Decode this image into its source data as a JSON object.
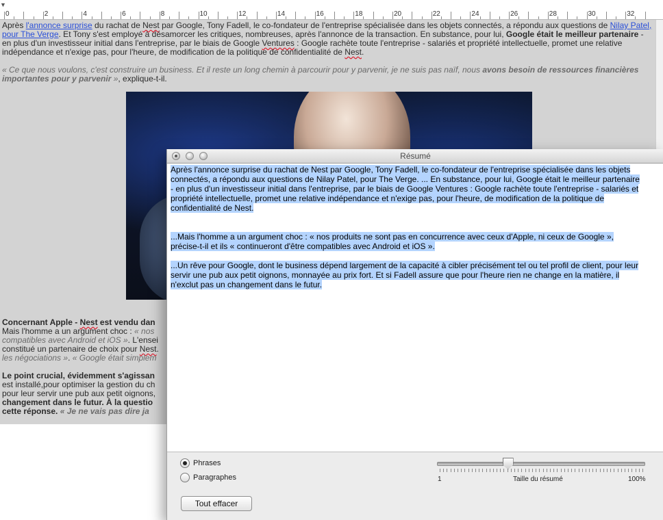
{
  "ruler": {
    "numbers": [
      "0",
      "2",
      "4",
      "6",
      "8",
      "10",
      "12",
      "14",
      "16",
      "18",
      "20",
      "22",
      "24",
      "26",
      "28",
      "30",
      "32"
    ]
  },
  "document": {
    "p1": {
      "a": "Après ",
      "link1": "l'annonce surprise",
      "b": " du rachat de ",
      "nest": "Nest",
      "c": " par Google, Tony Fadell, le co-fondateur de l'entreprise spécialisée dans les objets connectés, a répondu aux questions de ",
      "link2": "Nilay Patel, pour The Verge",
      "d": ". Et Tony s'est employé à désamorcer les critiques, nombreuses, après l'annonce de la transaction. En substance, pour lui, ",
      "bold1": "Google était le meilleur partenaire",
      "e": " - en plus d'un investisseur initial dans l'entreprise, par le biais de Google ",
      "ventures": "Ventures",
      "f": " : Google rachète toute l'entreprise - salariés et propriété intellectuelle, promet une relative indépendance et n'exige pas, pour l'heure, de modification de la politique de confidentialité de ",
      "nest2": "Nest",
      "g": "."
    },
    "p2": {
      "q1": "« Ce que nous voulons, c'est construire un business. Et il reste un long chemin à parcourir pour y parvenir, je ne suis pas naïf, nous ",
      "qbold": "avons besoin de ressources financières importantes pour y parvenir",
      "q2": " »",
      "after": ", explique-t-il."
    },
    "p3": {
      "bold": "Concernant Apple - ",
      "nest": "Nest",
      "bold2": " est vendu dan",
      "l2a": "Mais l'homme a un argument choc : ",
      "l2b": "« nos",
      "l3a": "compatibles avec Android et iOS »",
      "l3b": ". L'ensei",
      "l4": "constitué un partenaire de choix pour ",
      "l4nest": "Nest",
      "l4end": ".",
      "l5a": "les négociations »",
      "l5b": ". ",
      "l5c": "« Google était simplem"
    },
    "p4": {
      "l1": "Le point crucial, évidemment s'agissan",
      "l2": "est installé,pour optimiser la gestion du ch",
      "l3": "pour leur servir une pub aux petit oignons, ",
      "l4": "changement dans le futur. À la questio",
      "l5a": "cette réponse. ",
      "l5b": "« Je ne vais pas dire ja"
    }
  },
  "window": {
    "title": "Résumé",
    "summary": {
      "para1": "Après l'annonce surprise du rachat de Nest par Google, Tony Fadell, le co-fondateur de l'entreprise spécialisée dans les objets connectés, a répondu aux questions de Nilay Patel, pour The Verge. ...  En substance, pour lui, Google était le meilleur partenaire - en plus d'un investisseur initial dans l'entreprise, par le biais de Google Ventures : Google rachète toute l'entreprise - salariés et propriété intellectuelle, promet une relative indépendance et n'exige pas, pour l'heure, de modification de la politique de confidentialité de Nest.",
      "para2": "...Mais l'homme a un argument choc : « nos produits ne sont pas en concurrence avec ceux d'Apple, ni ceux de Google », précise-t-il et ils « continueront d'être compatibles avec Android et iOS ».",
      "para3": "...Un rêve pour Google, dont le business dépend largement de la capacité à cibler précisément tel ou tel profil de client, pour leur servir une pub aux petit oignons, monnayée au prix fort.   Et si Fadell assure que pour l'heure rien ne change en la matière, il n'exclut pas un changement dans le futur."
    },
    "options": {
      "sentences_label": "Phrases",
      "paragraphs_label": "Paragraphes",
      "selected": "Phrases"
    },
    "slider": {
      "min_label": "1",
      "caption": "Taille du résumé",
      "max_label": "100%",
      "value_fraction": 0.33
    },
    "clear_button": "Tout effacer"
  },
  "colors": {
    "selection": "#b4d4fe",
    "doc_background": "#d3d3d3",
    "link": "#2a4fd8"
  }
}
